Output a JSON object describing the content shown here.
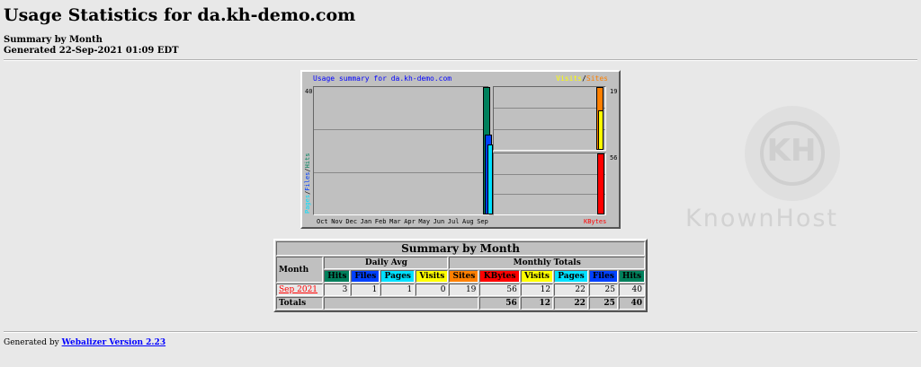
{
  "header": {
    "title": "Usage Statistics for da.kh-demo.com",
    "summary_label": "Summary by Month",
    "generated": "Generated 22-Sep-2021 01:09 EDT"
  },
  "watermark": {
    "letters": "KH",
    "text": "KnownHost"
  },
  "graph": {
    "title": "Usage summary for da.kh-demo.com",
    "legend_visits": "Visits",
    "legend_sep": "/",
    "legend_sites": "Sites",
    "left_axis_max": "40",
    "left_axis_label_pages": "Pages",
    "left_axis_label_files": "Files",
    "left_axis_label_hits": "Hits",
    "right_top_max": "19",
    "right_bottom_max": "56",
    "kbytes_label": "KBytes",
    "colors": {
      "hits": "#00805c",
      "files": "#0040ff",
      "pages": "#00e0ff",
      "visits": "#ffff00",
      "sites": "#ff8000",
      "kbytes": "#ff0000"
    }
  },
  "chart_data": {
    "type": "bar",
    "categories": [
      "Oct",
      "Nov",
      "Dec",
      "Jan",
      "Feb",
      "Mar",
      "Apr",
      "May",
      "Jun",
      "Jul",
      "Aug",
      "Sep"
    ],
    "series": [
      {
        "name": "Hits",
        "values": [
          0,
          0,
          0,
          0,
          0,
          0,
          0,
          0,
          0,
          0,
          0,
          40
        ]
      },
      {
        "name": "Files",
        "values": [
          0,
          0,
          0,
          0,
          0,
          0,
          0,
          0,
          0,
          0,
          0,
          25
        ]
      },
      {
        "name": "Pages",
        "values": [
          0,
          0,
          0,
          0,
          0,
          0,
          0,
          0,
          0,
          0,
          0,
          22
        ]
      },
      {
        "name": "Visits",
        "values": [
          0,
          0,
          0,
          0,
          0,
          0,
          0,
          0,
          0,
          0,
          0,
          12
        ]
      },
      {
        "name": "Sites",
        "values": [
          0,
          0,
          0,
          0,
          0,
          0,
          0,
          0,
          0,
          0,
          0,
          19
        ]
      },
      {
        "name": "KBytes",
        "values": [
          0,
          0,
          0,
          0,
          0,
          0,
          0,
          0,
          0,
          0,
          0,
          56
        ]
      }
    ]
  },
  "table": {
    "title": "Summary by Month",
    "month_header": "Month",
    "daily_avg_header": "Daily Avg",
    "monthly_totals_header": "Monthly Totals",
    "daily_cols": [
      "Hits",
      "Files",
      "Pages",
      "Visits"
    ],
    "monthly_cols": [
      "Sites",
      "KBytes",
      "Visits",
      "Pages",
      "Files",
      "Hits"
    ],
    "row": {
      "month": "Sep 2021",
      "values": [
        "3",
        "1",
        "1",
        "0",
        "19",
        "56",
        "12",
        "22",
        "25",
        "40"
      ]
    },
    "totals": {
      "label": "Totals",
      "values": [
        "56",
        "12",
        "22",
        "25",
        "40"
      ]
    }
  },
  "footer": {
    "prefix": "Generated by",
    "link": "Webalizer Version 2.23"
  }
}
